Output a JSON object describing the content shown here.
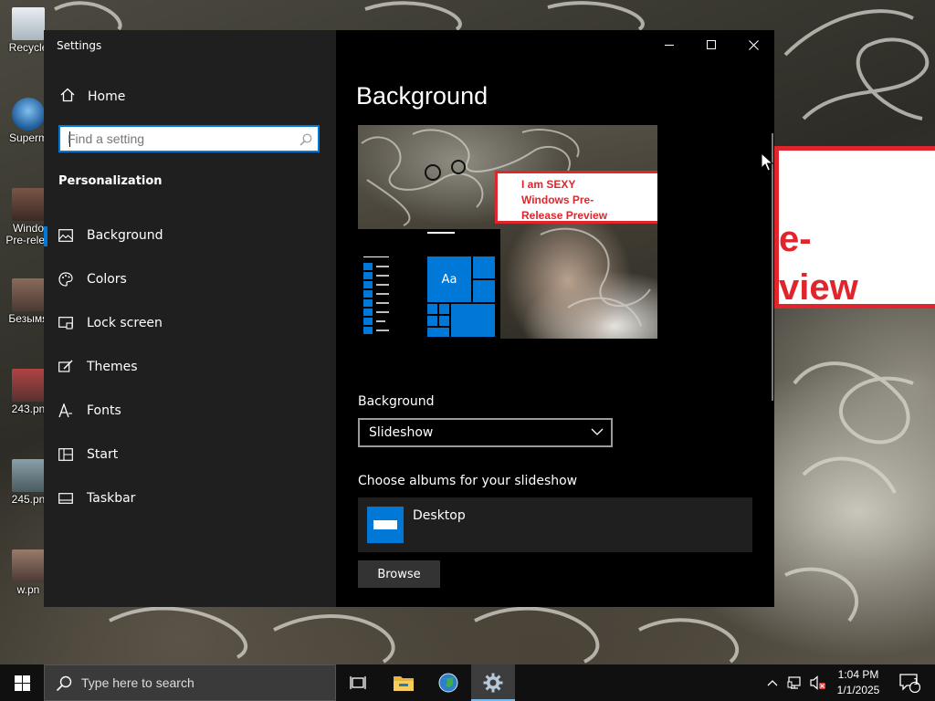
{
  "desktop": {
    "icons": [
      {
        "label": "Recycle",
        "name": "recycle-bin-icon"
      },
      {
        "label": "Superm",
        "name": "superm-shortcut-icon"
      },
      {
        "label": "Windo",
        "label2": "Pre-relea",
        "name": "windows-pre-release-icon"
      },
      {
        "label": "Безымя",
        "name": "image-file-icon"
      },
      {
        "label": "243.pn",
        "name": "image-file-243-icon"
      },
      {
        "label": "245.pn",
        "name": "image-file-245-icon"
      },
      {
        "label": "w.pn",
        "name": "image-file-w-icon"
      }
    ],
    "wallpaper_banner": {
      "line1": "e-",
      "line2": "view"
    }
  },
  "window": {
    "title": "Settings",
    "controls": {
      "minimize": "minimize",
      "maximize": "maximize",
      "close": "close"
    }
  },
  "nav": {
    "home_label": "Home",
    "search_placeholder": "Find a setting",
    "section_title": "Personalization",
    "items": [
      {
        "label": "Background",
        "icon": "picture-icon",
        "active": true
      },
      {
        "label": "Colors",
        "icon": "palette-icon"
      },
      {
        "label": "Lock screen",
        "icon": "lock-screen-icon"
      },
      {
        "label": "Themes",
        "icon": "brush-icon"
      },
      {
        "label": "Fonts",
        "icon": "font-icon"
      },
      {
        "label": "Start",
        "icon": "start-grid-icon"
      },
      {
        "label": "Taskbar",
        "icon": "taskbar-icon"
      }
    ]
  },
  "content": {
    "page_title": "Background",
    "preview": {
      "label_lines": [
        "I am SEXY",
        "Windows Pre-",
        "Release Preview"
      ],
      "tile_text": "Aa"
    },
    "background_label": "Background",
    "background_value": "Slideshow",
    "albums_label": "Choose albums for your slideshow",
    "album_name": "Desktop",
    "browse_label": "Browse"
  },
  "taskbar": {
    "search_placeholder": "Type here to search",
    "time": "1:04 PM",
    "date": "1/1/2025",
    "notification_count": "1",
    "accent": "#0078d7"
  }
}
